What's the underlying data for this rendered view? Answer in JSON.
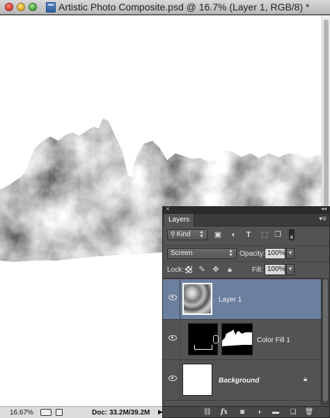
{
  "window": {
    "title": "Artistic Photo Composite.psd @ 16.7% (Layer 1, RGB/8) *"
  },
  "status": {
    "zoom": "16.67%",
    "doc_size": "Doc: 33.2M/39.2M",
    "arrow": "▶"
  },
  "layers_panel": {
    "tab_label": "Layers",
    "close_glyph": "×",
    "collapse_glyph": "◂◂",
    "menu_glyph": "▾≡",
    "filter": {
      "kind_label": "Kind",
      "kind_icon": "⚲"
    },
    "blend_mode": "Screen",
    "opacity_label": "Opacity:",
    "opacity_value": "100%",
    "lock_label": "Lock:",
    "fill_label": "Fill:",
    "fill_value": "100%",
    "layers": [
      {
        "name": "Layer 1",
        "selected": true,
        "visible": true,
        "thumbnail": "cloud-texture"
      },
      {
        "name": "Color Fill 1",
        "selected": false,
        "visible": true,
        "thumbnail": "black-fill-with-mask",
        "mask": "mountain-silhouette"
      },
      {
        "name": "Background",
        "selected": false,
        "visible": true,
        "thumbnail": "white",
        "locked": true,
        "italic": true
      }
    ]
  },
  "colors": {
    "panel_bg": "#535353",
    "selected_row": "#6b7f9e",
    "canvas_bg": "#ffffff"
  }
}
